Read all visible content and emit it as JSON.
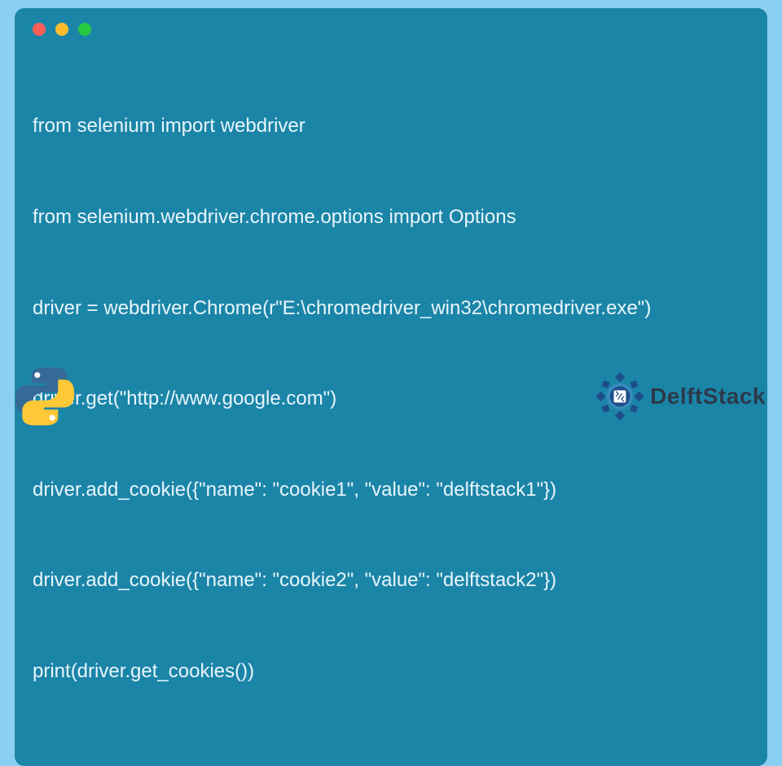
{
  "code": {
    "lines": [
      "from selenium import webdriver",
      "from selenium.webdriver.chrome.options import Options",
      "driver = webdriver.Chrome(r\"E:\\chromedriver_win32\\chromedriver.exe\")",
      "driver.get(\"http://www.google.com\")",
      "driver.add_cookie({\"name\": \"cookie1\", \"value\": \"delftstack1\"})",
      "driver.add_cookie({\"name\": \"cookie2\", \"value\": \"delftstack2\"})",
      "print(driver.get_cookies())"
    ]
  },
  "brand": {
    "name": "DelftStack"
  },
  "colors": {
    "bg": "#8bd0f2",
    "window": "#1b85a8",
    "text": "#e8f5fb"
  },
  "traffic_lights": {
    "red": "#ff5f56",
    "yellow": "#ffbd2e",
    "green": "#27c93f"
  }
}
